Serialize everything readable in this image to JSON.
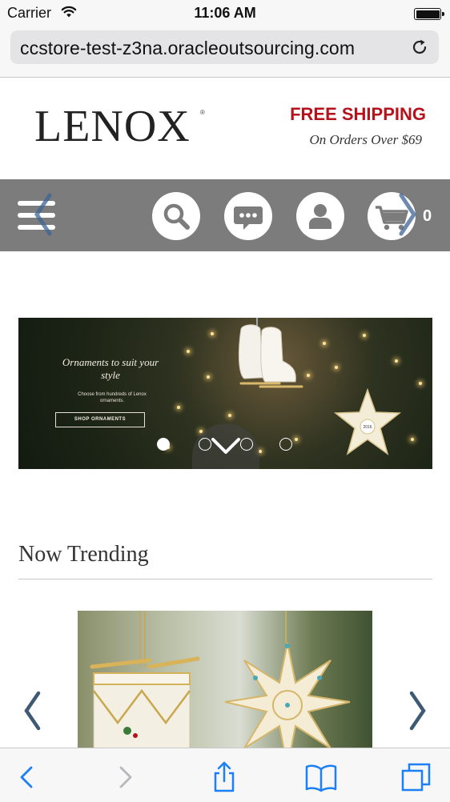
{
  "status_bar": {
    "carrier": "Carrier",
    "time": "11:06 AM"
  },
  "browser": {
    "url": "ccstore-test-z3na.oracleoutsourcing.com"
  },
  "header": {
    "logo": "LENOX",
    "logo_mark": "®",
    "shipping_title": "FREE SHIPPING",
    "shipping_subtitle": "On Orders Over $69"
  },
  "nav": {
    "icons": [
      "menu-icon",
      "search-icon",
      "chat-icon",
      "account-icon",
      "cart-icon"
    ],
    "cart_count": "0"
  },
  "hero": {
    "title": "Ornaments to suit your style",
    "subtitle": "Choose from hundreds of Lenox ornaments.",
    "button_label": "SHOP ORNAMENTS",
    "star_year": "2016",
    "slides_total": 4,
    "active_slide": 1
  },
  "trending": {
    "title": "Now Trending"
  },
  "toolbar": {
    "icons": [
      "back-icon",
      "forward-icon",
      "share-icon",
      "bookmarks-icon",
      "tabs-icon"
    ]
  },
  "colors": {
    "brand_red": "#b5121b",
    "nav_gray": "#7c7c7c",
    "ios_blue": "#1b7ff5"
  }
}
